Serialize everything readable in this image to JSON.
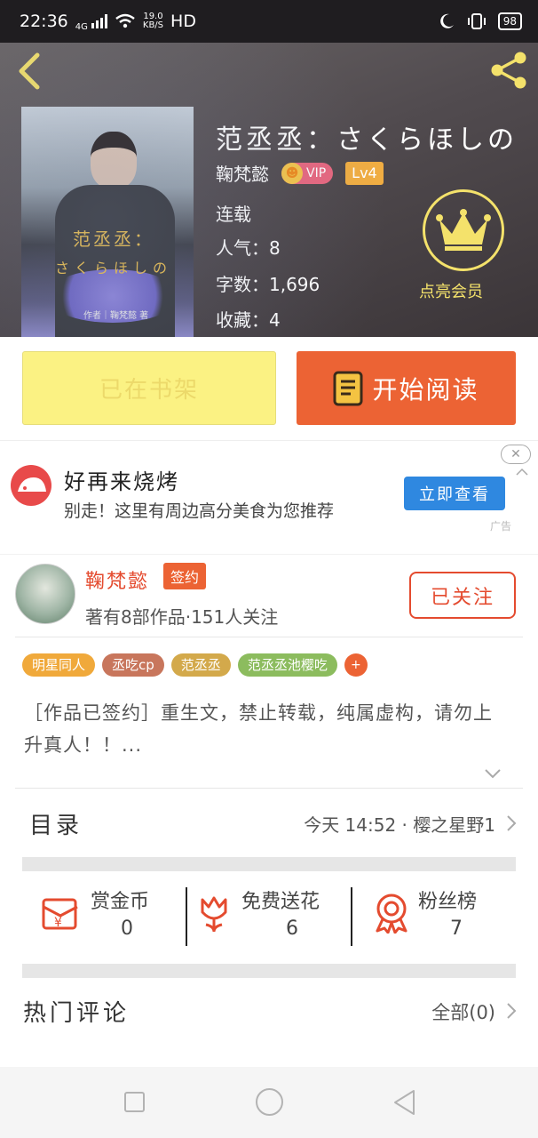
{
  "status_bar": {
    "time": "22:36",
    "network": "4G",
    "speed_value": "19.0",
    "speed_unit": "KB/S",
    "hd": "HD",
    "battery": "98"
  },
  "book": {
    "title": "范丞丞：さくらほしの",
    "author": "鞠梵懿",
    "vip_label": "VIP",
    "level": "Lv4",
    "status": "连载",
    "popularity": "人气：8",
    "word_count": "字数：1,696",
    "favorites": "收藏：4",
    "cover_title_line1": "范丞丞：",
    "cover_title_line2": "さくらほしの",
    "cover_author": "作者｜鞠梵懿 著",
    "member_label": "点亮会员"
  },
  "actions": {
    "shelf_label": "已在书架",
    "read_label": "开始阅读"
  },
  "ad": {
    "title": "好再来烧烤",
    "description": "别走！这里有周边高分美食为您推荐",
    "button_label": "立即查看",
    "ad_mark": "广告"
  },
  "author_section": {
    "name": "鞠梵懿",
    "signed_badge": "签约",
    "works_info": "著有8部作品·151人关注",
    "follow_label": "已关注"
  },
  "tags": [
    {
      "label": "明星同人",
      "color": "#f0a93b"
    },
    {
      "label": "丞吃cp",
      "color": "#c8765c"
    },
    {
      "label": "范丞丞",
      "color": "#d3a94b"
    },
    {
      "label": "范丞丞池樱吃",
      "color": "#8cbc5e"
    }
  ],
  "tag_more": "+",
  "description": "［作品已签约］重生文，禁止转载，纯属虚构，请勿上升真人！！...",
  "catalog": {
    "label": "目录",
    "latest": "今天 14:52 · 樱之星野1"
  },
  "stats": [
    {
      "label": "赏金币",
      "value": "0",
      "icon": "reward-coin-icon"
    },
    {
      "label": "免费送花",
      "value": "6",
      "icon": "flower-icon"
    },
    {
      "label": "粉丝榜",
      "value": "7",
      "icon": "medal-icon"
    }
  ],
  "comments": {
    "label": "热门评论",
    "all_label": "全部(0)"
  },
  "colors": {
    "accent": "#ec6334",
    "shelf": "#fbf283",
    "gold": "#f4e26b",
    "ad_button": "#2f88e0"
  }
}
